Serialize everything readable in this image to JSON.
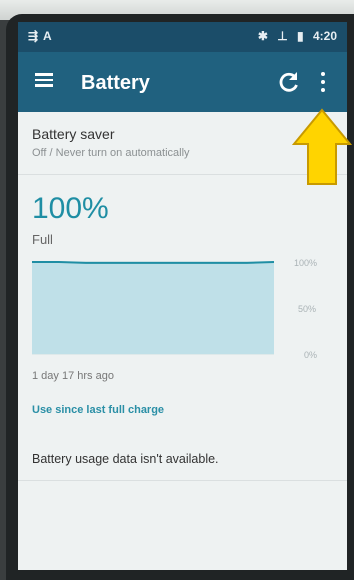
{
  "status_bar": {
    "left_icons": "⇶ A",
    "bluetooth_icon": "✱",
    "usb_icon": "⊥",
    "time": "4:20"
  },
  "app_bar": {
    "title": "Battery",
    "background": "#20617f"
  },
  "battery_saver": {
    "title": "Battery saver",
    "subtitle": "Off / Never turn on automatically"
  },
  "battery": {
    "level_display": "100%",
    "state": "Full",
    "level_fraction": 1.0
  },
  "chart_data": {
    "type": "area",
    "y_ticks": [
      "100%",
      "50%",
      "0%"
    ],
    "ylim": [
      0,
      100
    ],
    "series": [
      {
        "values": [
          100,
          100,
          99,
          99,
          99,
          99,
          99,
          99,
          99,
          100
        ]
      }
    ]
  },
  "history": {
    "since_text": "1 day 17 hrs ago",
    "link_label": "Use since last full charge",
    "no_data_text": "Battery usage data isn't available."
  },
  "colors": {
    "accent": "#1f8ea4",
    "arrow_fill": "#ffd400"
  }
}
